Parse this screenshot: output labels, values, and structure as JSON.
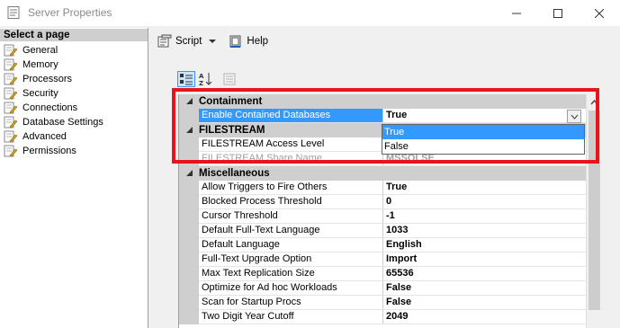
{
  "window": {
    "title": "Server Properties"
  },
  "left_pane": {
    "header": "Select a page",
    "pages": [
      "General",
      "Memory",
      "Processors",
      "Security",
      "Connections",
      "Database Settings",
      "Advanced",
      "Permissions"
    ]
  },
  "toolbar": {
    "script_label": "Script",
    "help_label": "Help"
  },
  "grid": {
    "categories": {
      "containment": "Containment",
      "filestream": "FILESTREAM",
      "misc": "Miscellaneous"
    },
    "containment_rows": [
      {
        "name": "Enable Contained Databases",
        "value": "True"
      }
    ],
    "filestream_rows": [
      {
        "name": "FILESTREAM Access Level",
        "value": ""
      },
      {
        "name": "FILESTREAM Share Name",
        "value": "MSSQLSE"
      }
    ],
    "misc_rows": [
      {
        "name": "Allow Triggers to Fire Others",
        "value": "True"
      },
      {
        "name": "Blocked Process Threshold",
        "value": "0"
      },
      {
        "name": "Cursor Threshold",
        "value": "-1"
      },
      {
        "name": "Default Full-Text Language",
        "value": "1033"
      },
      {
        "name": "Default Language",
        "value": "English"
      },
      {
        "name": "Full-Text Upgrade Option",
        "value": "Import"
      },
      {
        "name": "Max Text Replication Size",
        "value": "65536"
      },
      {
        "name": "Optimize for Ad hoc Workloads",
        "value": "False"
      },
      {
        "name": "Scan for Startup Procs",
        "value": "False"
      },
      {
        "name": "Two Digit Year Cutoff",
        "value": "2049"
      }
    ]
  },
  "dropdown": {
    "options": [
      "True",
      "False"
    ],
    "selected": "True"
  },
  "colors": {
    "highlight": "#e8141b",
    "selection": "#3399ff",
    "category_bg": "#cfcfcf"
  },
  "icons": {
    "app": "server-properties-icon",
    "page": "wrench-page-icon",
    "script": "script-icon",
    "help": "help-icon",
    "categorized": "categorized-icon",
    "alphabetical": "alphabetical-sort-icon",
    "property_pages": "property-pages-icon"
  }
}
